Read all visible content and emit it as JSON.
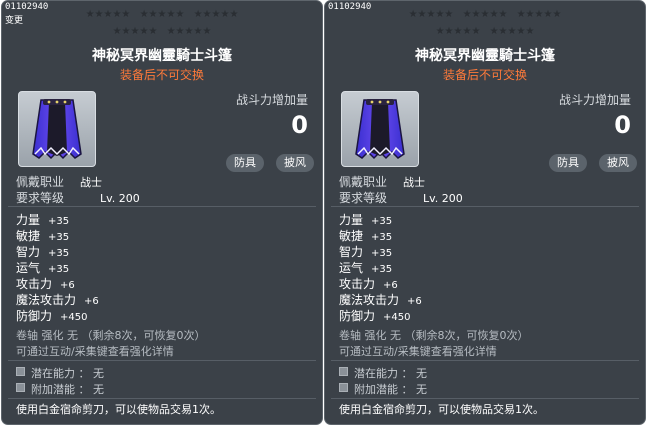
{
  "panels": [
    {
      "item_id": "01102940",
      "sub_label": "变更",
      "title": "神秘冥界幽靈騎士斗篷",
      "trade_notice": "装备后不可交换",
      "stars_row1": [
        "★★★★★",
        "★★★★★",
        "★★★★★"
      ],
      "stars_row2": [
        "★★★★★",
        "★★★★★"
      ],
      "combat_power_label": "战斗力增加量",
      "combat_power_value": "0",
      "tags": [
        "防具",
        "披风"
      ],
      "job_label": "佩戴职业",
      "job_value": "战士",
      "level_label": "要求等级",
      "level_value": "Lv. 200",
      "stats": [
        {
          "label": "力量",
          "value": "+35"
        },
        {
          "label": "敏捷",
          "value": "+35"
        },
        {
          "label": "智力",
          "value": "+35"
        },
        {
          "label": "运气",
          "value": "+35"
        },
        {
          "label": "攻击力",
          "value": "+6"
        },
        {
          "label": "魔法攻击力",
          "value": "+6"
        },
        {
          "label": "防御力",
          "value": "+450"
        }
      ],
      "scroll_note": "卷轴 强化 无 （剩余8次，可恢复0次）",
      "inspect_note": "可通过互动/采集键查看强化详情",
      "potential": [
        {
          "label": "潜在能力",
          "value": "无"
        },
        {
          "label": "附加潜能",
          "value": "无"
        }
      ],
      "footer": "使用白金宿命剪刀，可以使物品交易1次。"
    },
    {
      "item_id": "01102940",
      "sub_label": "",
      "title": "神秘冥界幽靈騎士斗篷",
      "trade_notice": "装备后不可交换",
      "stars_row1": [
        "★★★★★",
        "★★★★★",
        "★★★★★"
      ],
      "stars_row2": [
        "★★★★★",
        "★★★★★"
      ],
      "combat_power_label": "战斗力增加量",
      "combat_power_value": "0",
      "tags": [
        "防具",
        "披风"
      ],
      "job_label": "佩戴职业",
      "job_value": "战士",
      "level_label": "要求等级",
      "level_value": "Lv. 200",
      "stats": [
        {
          "label": "力量",
          "value": "+35"
        },
        {
          "label": "敏捷",
          "value": "+35"
        },
        {
          "label": "智力",
          "value": "+35"
        },
        {
          "label": "运气",
          "value": "+35"
        },
        {
          "label": "攻击力",
          "value": "+6"
        },
        {
          "label": "魔法攻击力",
          "value": "+6"
        },
        {
          "label": "防御力",
          "value": "+450"
        }
      ],
      "scroll_note": "卷轴 强化 无 （剩余8次，可恢复0次）",
      "inspect_note": "可通过互动/采集键查看强化详情",
      "potential": [
        {
          "label": "潜在能力",
          "value": "无"
        },
        {
          "label": "附加潜能",
          "value": "无"
        }
      ],
      "footer": "使用白金宿命剪刀，可以使物品交易1次。"
    }
  ],
  "colors": {
    "panel_bg": "#3b4148",
    "trade_notice": "#ff7a3a",
    "star_empty": "#2a2e33"
  },
  "icons": {
    "item": "cape-icon",
    "potential_bullet": "square-bullet-icon"
  }
}
